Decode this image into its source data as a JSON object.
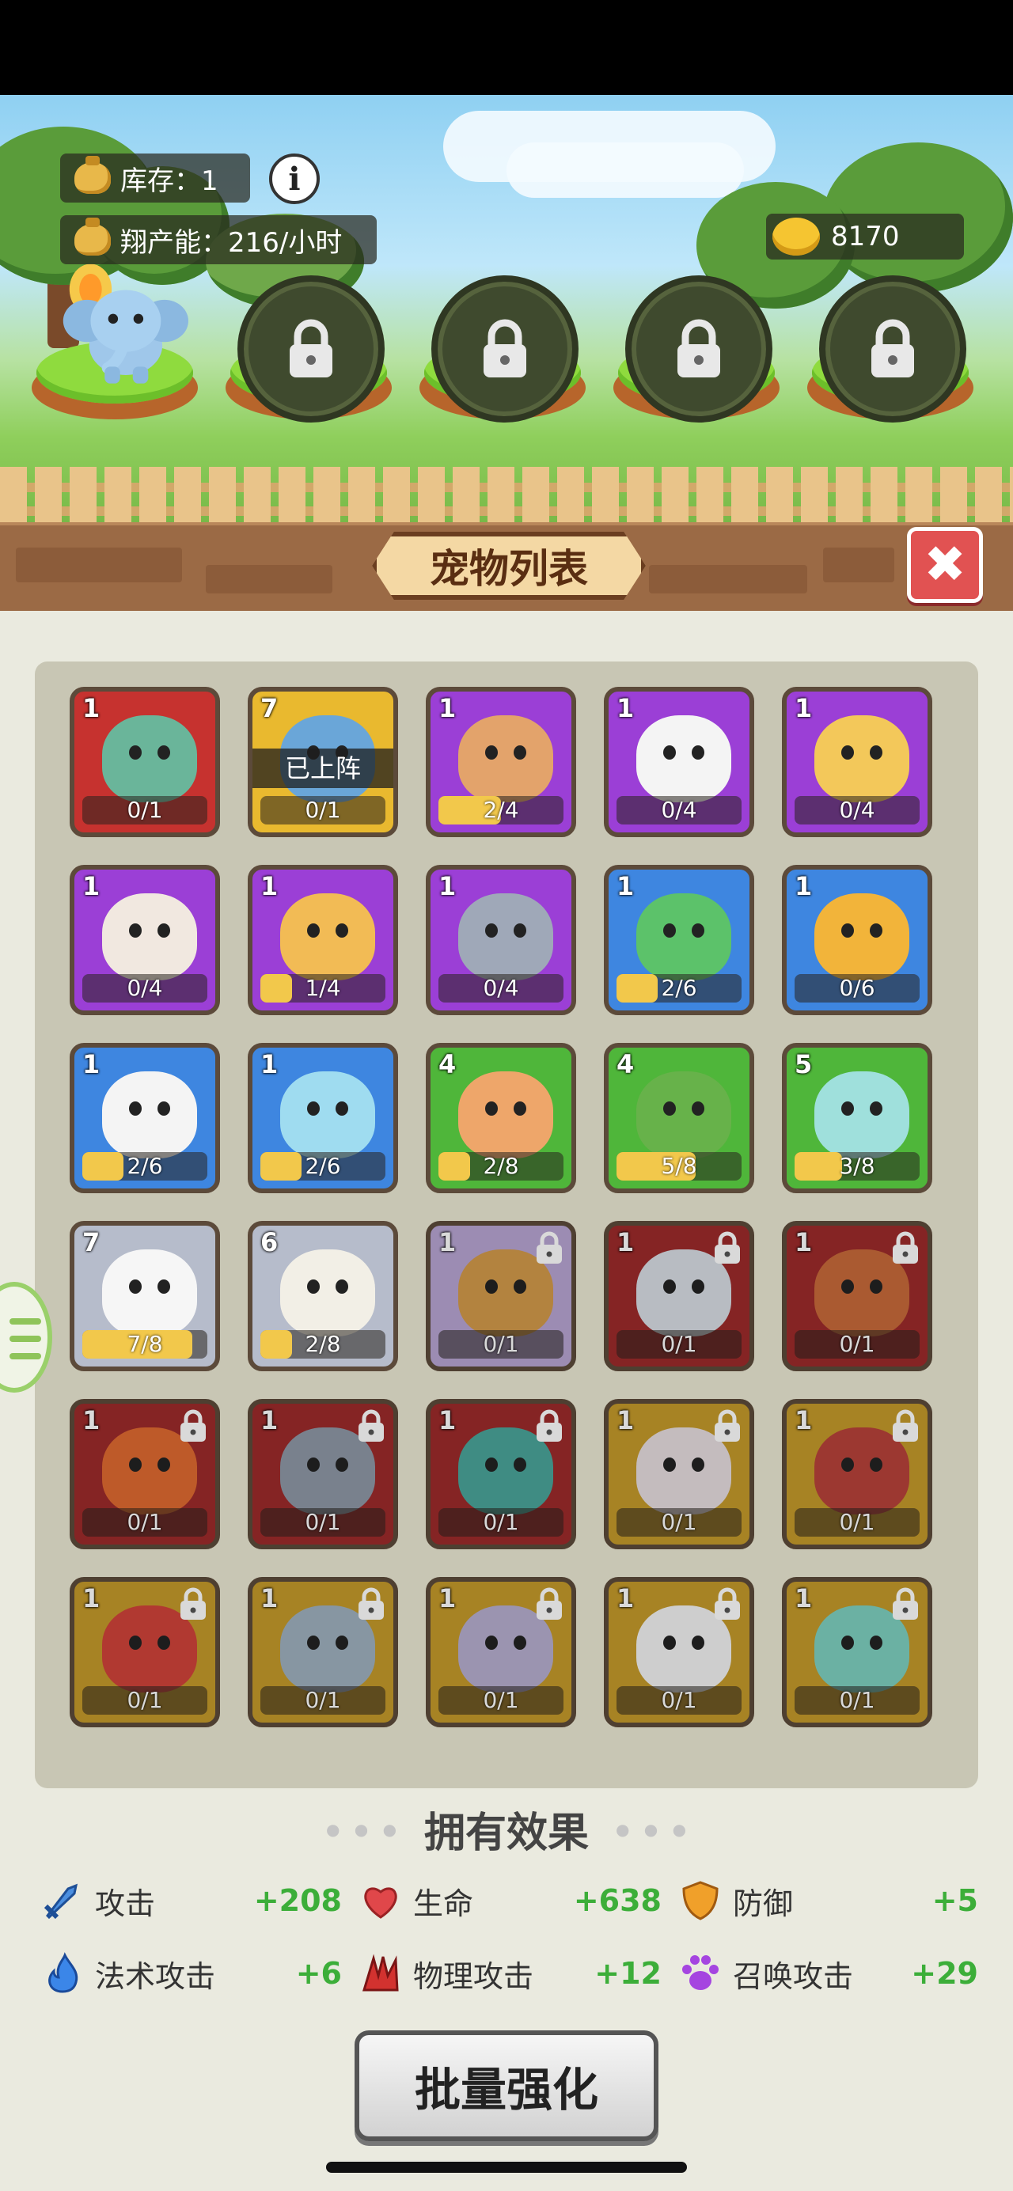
{
  "hud": {
    "stock_label": "库存：1",
    "rate_label": "翔产能：216/小时",
    "info_label": "i",
    "gold_amount": "8170"
  },
  "panel": {
    "title": "宠物列表",
    "close_label": "✖"
  },
  "pets": [
    {
      "level": "1",
      "progress": "0/1",
      "fill": 0,
      "rarity": "red",
      "color": "#6ab59a",
      "locked": false
    },
    {
      "level": "7",
      "progress": "0/1",
      "fill": 0,
      "rarity": "gold",
      "color": "#6aa6d8",
      "locked": false,
      "badge": "已上阵"
    },
    {
      "level": "1",
      "progress": "2/4",
      "fill": 0.5,
      "rarity": "purple",
      "color": "#e3a36b",
      "locked": false
    },
    {
      "level": "1",
      "progress": "0/4",
      "fill": 0,
      "rarity": "purple",
      "color": "#f4f4f4",
      "locked": false
    },
    {
      "level": "1",
      "progress": "0/4",
      "fill": 0,
      "rarity": "purple",
      "color": "#f3c85a",
      "locked": false
    },
    {
      "level": "1",
      "progress": "0/4",
      "fill": 0,
      "rarity": "purple",
      "color": "#f1e8e0",
      "locked": false
    },
    {
      "level": "1",
      "progress": "1/4",
      "fill": 0.25,
      "rarity": "purple",
      "color": "#f2bb55",
      "locked": false
    },
    {
      "level": "1",
      "progress": "0/4",
      "fill": 0,
      "rarity": "purple",
      "color": "#9fa8b8",
      "locked": false
    },
    {
      "level": "1",
      "progress": "2/6",
      "fill": 0.33,
      "rarity": "blue",
      "color": "#5cc26a",
      "locked": false
    },
    {
      "level": "1",
      "progress": "0/6",
      "fill": 0,
      "rarity": "blue",
      "color": "#f2b43a",
      "locked": false
    },
    {
      "level": "1",
      "progress": "2/6",
      "fill": 0.33,
      "rarity": "blue",
      "color": "#f4f4f4",
      "locked": false
    },
    {
      "level": "1",
      "progress": "2/6",
      "fill": 0.33,
      "rarity": "blue",
      "color": "#9fdcf0",
      "locked": false
    },
    {
      "level": "4",
      "progress": "2/8",
      "fill": 0.25,
      "rarity": "green",
      "color": "#eea66a",
      "locked": false
    },
    {
      "level": "4",
      "progress": "5/8",
      "fill": 0.625,
      "rarity": "green",
      "color": "#67b24a",
      "locked": false
    },
    {
      "level": "5",
      "progress": "3/8",
      "fill": 0.375,
      "rarity": "green",
      "color": "#9fe0dc",
      "locked": false
    },
    {
      "level": "7",
      "progress": "7/8",
      "fill": 0.875,
      "rarity": "gray",
      "color": "#f6f6f6",
      "locked": false
    },
    {
      "level": "6",
      "progress": "2/8",
      "fill": 0.25,
      "rarity": "gray",
      "color": "#f2efe6",
      "locked": false
    },
    {
      "level": "1",
      "progress": "0/1",
      "fill": 0,
      "rarity": "lp",
      "color": "#d29a4a",
      "locked": true
    },
    {
      "level": "1",
      "progress": "0/1",
      "fill": 0,
      "rarity": "dred",
      "color": "#d8dde4",
      "locked": true
    },
    {
      "level": "1",
      "progress": "0/1",
      "fill": 0,
      "rarity": "dred",
      "color": "#c86a3a",
      "locked": true
    },
    {
      "level": "1",
      "progress": "0/1",
      "fill": 0,
      "rarity": "dred",
      "color": "#e06a30",
      "locked": true
    },
    {
      "level": "1",
      "progress": "0/1",
      "fill": 0,
      "rarity": "dred",
      "color": "#8e98a6",
      "locked": true
    },
    {
      "level": "1",
      "progress": "0/1",
      "fill": 0,
      "rarity": "dred",
      "color": "#4aa59a",
      "locked": true
    },
    {
      "level": "1",
      "progress": "0/1",
      "fill": 0,
      "rarity": "dgold",
      "color": "#e7dde0",
      "locked": true
    },
    {
      "level": "1",
      "progress": "0/1",
      "fill": 0,
      "rarity": "dgold",
      "color": "#b8423a",
      "locked": true
    },
    {
      "level": "1",
      "progress": "0/1",
      "fill": 0,
      "rarity": "dgold",
      "color": "#d0433a",
      "locked": true
    },
    {
      "level": "1",
      "progress": "0/1",
      "fill": 0,
      "rarity": "dgold",
      "color": "#9fb0bf",
      "locked": true
    },
    {
      "level": "1",
      "progress": "0/1",
      "fill": 0,
      "rarity": "dgold",
      "color": "#b6aecf",
      "locked": true
    },
    {
      "level": "1",
      "progress": "0/1",
      "fill": 0,
      "rarity": "dgold",
      "color": "#f2f2f2",
      "locked": true
    },
    {
      "level": "1",
      "progress": "0/1",
      "fill": 0,
      "rarity": "dgold",
      "color": "#7ed0c0",
      "locked": true
    }
  ],
  "effects": {
    "title": "拥有效果",
    "stats": [
      {
        "label": "攻击",
        "value": "+208",
        "icon": "sword-icon",
        "color": "#4b8fe0"
      },
      {
        "label": "生命",
        "value": "+638",
        "icon": "heart-icon",
        "color": "#e0474a"
      },
      {
        "label": "防御",
        "value": "+5",
        "icon": "shield-icon",
        "color": "#f0a02a"
      },
      {
        "label": "法术攻击",
        "value": "+6",
        "icon": "flame-icon",
        "color": "#3b86e8"
      },
      {
        "label": "物理攻击",
        "value": "+12",
        "icon": "claw-icon",
        "color": "#d2322f"
      },
      {
        "label": "召唤攻击",
        "value": "+29",
        "icon": "paw-icon",
        "color": "#a545e0"
      }
    ]
  },
  "batch_button": "批量强化"
}
